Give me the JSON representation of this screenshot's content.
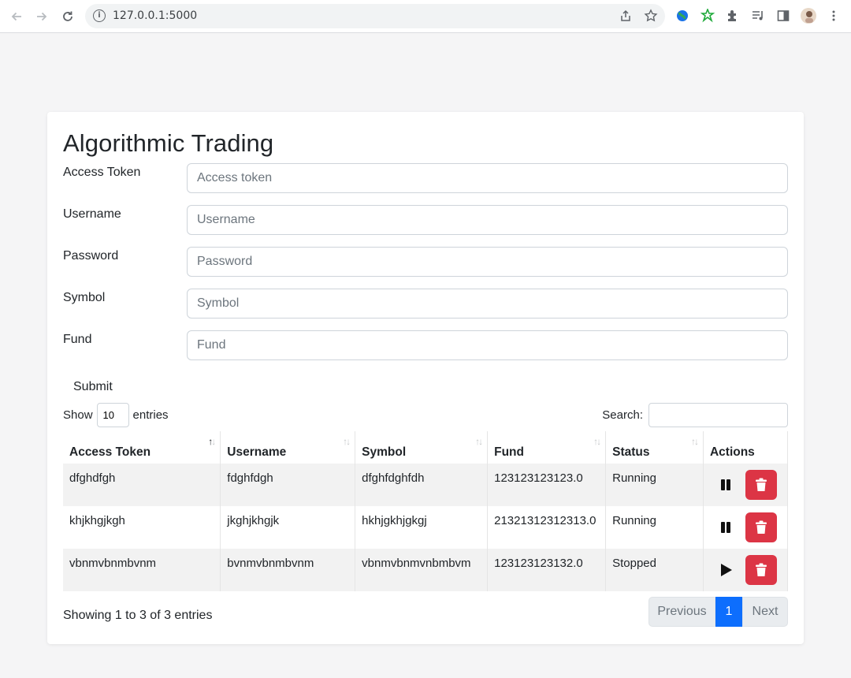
{
  "browser": {
    "url": "127.0.0.1:5000"
  },
  "page": {
    "title": "Algorithmic Trading"
  },
  "form": {
    "fields": [
      {
        "label": "Access Token",
        "placeholder": "Access token"
      },
      {
        "label": "Username",
        "placeholder": "Username"
      },
      {
        "label": "Password",
        "placeholder": "Password"
      },
      {
        "label": "Symbol",
        "placeholder": "Symbol"
      },
      {
        "label": "Fund",
        "placeholder": "Fund"
      }
    ],
    "submit_label": "Submit"
  },
  "table_controls": {
    "show_label": "Show",
    "entries_value": "10",
    "entries_label": "entries",
    "search_label": "Search:"
  },
  "table": {
    "columns": [
      "Access Token",
      "Username",
      "Symbol",
      "Fund",
      "Status",
      "Actions"
    ],
    "rows": [
      {
        "access_token": "dfghdfgh",
        "username": "fdghfdgh",
        "symbol": "dfghfdghfdh",
        "fund": "123123123123.0",
        "status": "Running",
        "action": "pause"
      },
      {
        "access_token": "khjkhgjkgh",
        "username": "jkghjkhgjk",
        "symbol": "hkhjgkhjgkgj",
        "fund": "21321312312313.0",
        "status": "Running",
        "action": "pause"
      },
      {
        "access_token": "vbnmvbnmbvnm",
        "username": "bvnmvbnmbvnm",
        "symbol": "vbnmvbnmvnbmbvm",
        "fund": "123123123132.0",
        "status": "Stopped",
        "action": "play"
      }
    ]
  },
  "footer": {
    "info": "Showing 1 to 3 of 3 entries",
    "previous": "Previous",
    "current_page": "1",
    "next": "Next"
  },
  "colors": {
    "danger": "#dc3545",
    "primary": "#0d6efd"
  }
}
